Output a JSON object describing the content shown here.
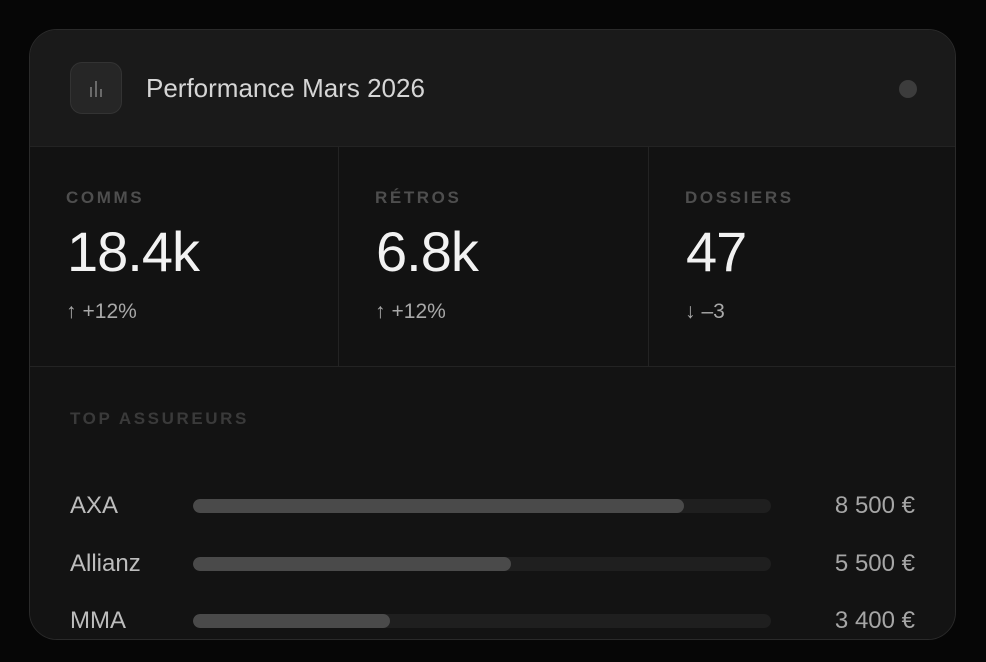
{
  "header": {
    "title": "Performance Mars 2026",
    "icon": "bar-chart-icon",
    "status_dot_color": "#3c3c3c"
  },
  "metrics": [
    {
      "label": "COMMS",
      "value": "18.4k",
      "delta_arrow": "↑",
      "delta": "+12%",
      "trend": "up"
    },
    {
      "label": "RÉTROS",
      "value": "6.8k",
      "delta_arrow": "↑",
      "delta": "+12%",
      "trend": "up"
    },
    {
      "label": "DOSSIERS",
      "value": "47",
      "delta_arrow": "↓",
      "delta": "–3",
      "trend": "down"
    }
  ],
  "top_insurers": {
    "label": "TOP ASSUREURS",
    "rows": [
      {
        "name": "AXA",
        "amount": "8 500 €",
        "share": 0.85
      },
      {
        "name": "Allianz",
        "amount": "5 500 €",
        "share": 0.55
      },
      {
        "name": "MMA",
        "amount": "3 400 €",
        "share": 0.34
      }
    ]
  }
}
